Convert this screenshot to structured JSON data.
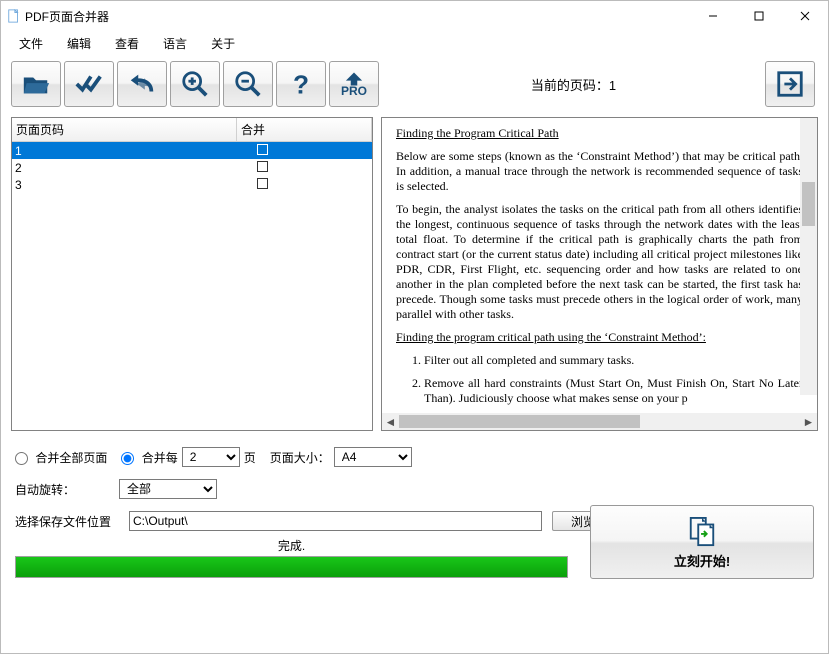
{
  "window": {
    "title": "PDF页面合并器"
  },
  "menu": {
    "file": "文件",
    "edit": "编辑",
    "view": "查看",
    "language": "语言",
    "about": "关于"
  },
  "toolbar": {
    "open": "open",
    "apply": "apply-all",
    "undo": "undo",
    "zoom_in": "zoom-in",
    "zoom_out": "zoom-out",
    "help": "help",
    "pro": "PRO",
    "page_label": "当前的页码：1",
    "exit": "exit"
  },
  "table": {
    "col_page": "页面页码",
    "col_merge": "合并",
    "rows": [
      {
        "page": "1",
        "merge": false,
        "selected": true
      },
      {
        "page": "2",
        "merge": false,
        "selected": false
      },
      {
        "page": "3",
        "merge": false,
        "selected": false
      }
    ]
  },
  "preview": {
    "h1": "Finding the Program Critical Path",
    "p1": "Below are some steps (known as the ‘Constraint Method’) that may be critical path. In addition, a manual trace through the network is recommended sequence of tasks is selected.",
    "p2": "To begin, the analyst isolates the tasks on the critical path from all others identifies the longest, continuous sequence of tasks through the network dates with the least total float. To determine if the critical path is graphically charts the path from contract start (or the current status date) including all critical project milestones like PDR, CDR, First Flight, etc. sequencing order and how tasks are related to one another in the plan completed before the next task can be started, the first task has precede. Though some tasks must precede others in the logical order of work, many parallel with other tasks.",
    "h2": "Finding the program critical path using the ‘Constraint Method’:",
    "li1": "Filter out all completed and summary tasks.",
    "li2": "Remove all hard constraints (Must Start On, Must Finish On, Start No Later Than).  Judiciously choose what makes sense on your p"
  },
  "options": {
    "merge_all": "合并全部页面",
    "merge_every": "合并每",
    "pages_value": "2",
    "pages_unit": "页",
    "page_size_label": "页面大小：",
    "page_size_value": "A4",
    "auto_rotate_label": "自动旋转：",
    "auto_rotate_value": "全部",
    "output_label": "选择保存文件位置",
    "output_path": "C:\\Output\\",
    "browse": "浏览"
  },
  "progress": {
    "label": "完成."
  },
  "start": {
    "label": "立刻开始!"
  }
}
